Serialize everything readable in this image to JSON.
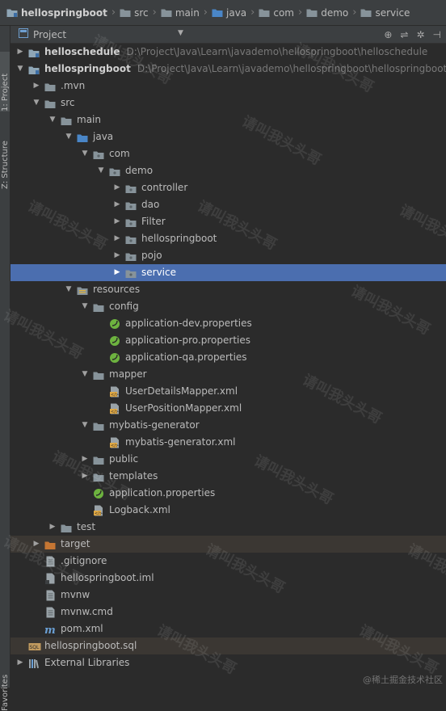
{
  "breadcrumb": [
    {
      "label": "hellospringboot",
      "icon": "module-folder-icon"
    },
    {
      "label": "src",
      "icon": "folder-icon"
    },
    {
      "label": "main",
      "icon": "folder-icon"
    },
    {
      "label": "java",
      "icon": "source-folder-icon"
    },
    {
      "label": "com",
      "icon": "folder-icon"
    },
    {
      "label": "demo",
      "icon": "folder-icon"
    },
    {
      "label": "service",
      "icon": "folder-icon"
    }
  ],
  "side_tabs": {
    "project": "1: Project",
    "structure": "Z: Structure",
    "favorites": "Favorites"
  },
  "panel": {
    "title": "Project"
  },
  "tree": [
    {
      "label": "helloschedule",
      "path": "D:\\Project\\Java\\Learn\\javademo\\hellospringboot\\helloschedule",
      "icon": "module-icon",
      "level": 0,
      "arrow": "right",
      "bold": true
    },
    {
      "label": "hellospringboot",
      "path": "D:\\Project\\Java\\Learn\\javademo\\hellospringboot\\hellospringboot",
      "icon": "module-icon",
      "level": 0,
      "arrow": "down",
      "bold": true
    },
    {
      "label": ".mvn",
      "icon": "folder-icon",
      "level": 1,
      "arrow": "right"
    },
    {
      "label": "src",
      "icon": "folder-icon",
      "level": 1,
      "arrow": "down"
    },
    {
      "label": "main",
      "icon": "folder-icon",
      "level": 2,
      "arrow": "down"
    },
    {
      "label": "java",
      "icon": "source-folder-icon",
      "level": 3,
      "arrow": "down"
    },
    {
      "label": "com",
      "icon": "package-icon",
      "level": 4,
      "arrow": "down"
    },
    {
      "label": "demo",
      "icon": "package-icon",
      "level": 5,
      "arrow": "down"
    },
    {
      "label": "controller",
      "icon": "package-icon",
      "level": 6,
      "arrow": "right"
    },
    {
      "label": "dao",
      "icon": "package-icon",
      "level": 6,
      "arrow": "right"
    },
    {
      "label": "Filter",
      "icon": "package-icon",
      "level": 6,
      "arrow": "right"
    },
    {
      "label": "hellospringboot",
      "icon": "package-icon",
      "level": 6,
      "arrow": "right"
    },
    {
      "label": "pojo",
      "icon": "package-icon",
      "level": 6,
      "arrow": "right"
    },
    {
      "label": "service",
      "icon": "package-icon",
      "level": 6,
      "arrow": "right",
      "selected": true
    },
    {
      "label": "resources",
      "icon": "resources-folder-icon",
      "level": 3,
      "arrow": "down"
    },
    {
      "label": "config",
      "icon": "folder-icon",
      "level": 4,
      "arrow": "down"
    },
    {
      "label": "application-dev.properties",
      "icon": "spring-properties-icon",
      "level": 5
    },
    {
      "label": "application-pro.properties",
      "icon": "spring-properties-icon",
      "level": 5
    },
    {
      "label": "application-qa.properties",
      "icon": "spring-properties-icon",
      "level": 5
    },
    {
      "label": "mapper",
      "icon": "folder-icon",
      "level": 4,
      "arrow": "down"
    },
    {
      "label": "UserDetailsMapper.xml",
      "icon": "xml-file-icon",
      "level": 5
    },
    {
      "label": "UserPositionMapper.xml",
      "icon": "xml-file-icon",
      "level": 5
    },
    {
      "label": "mybatis-generator",
      "icon": "folder-icon",
      "level": 4,
      "arrow": "down"
    },
    {
      "label": "mybatis-generator.xml",
      "icon": "xml-file-icon",
      "level": 5
    },
    {
      "label": "public",
      "icon": "folder-icon",
      "level": 4,
      "arrow": "right"
    },
    {
      "label": "templates",
      "icon": "folder-icon",
      "level": 4,
      "arrow": "right"
    },
    {
      "label": "application.properties",
      "icon": "spring-properties-icon",
      "level": 4
    },
    {
      "label": "Logback.xml",
      "icon": "xml-file-icon",
      "level": 4
    },
    {
      "label": "test",
      "icon": "folder-icon",
      "level": 2,
      "arrow": "right"
    },
    {
      "label": "target",
      "icon": "excluded-folder-icon",
      "level": 1,
      "arrow": "right",
      "highlight": true
    },
    {
      "label": ".gitignore",
      "icon": "text-file-icon",
      "level": 1
    },
    {
      "label": "hellospringboot.iml",
      "icon": "iml-file-icon",
      "level": 1
    },
    {
      "label": "mvnw",
      "icon": "text-file-icon",
      "level": 1
    },
    {
      "label": "mvnw.cmd",
      "icon": "text-file-icon",
      "level": 1
    },
    {
      "label": "pom.xml",
      "icon": "maven-icon",
      "level": 1
    },
    {
      "label": "hellospringboot.sql",
      "icon": "sql-file-icon",
      "level": 0,
      "highlight": true
    },
    {
      "label": "External Libraries",
      "icon": "libraries-icon",
      "level": 0,
      "arrow": "right"
    }
  ],
  "watermark": "请叫我头头哥",
  "site_mark": "@稀土掘金技术社区",
  "colors": {
    "selection": "#4b6eaf",
    "folder": "#87939a",
    "source": "#4a86c7",
    "package": "#87939a",
    "excluded": "#c57633",
    "spring": "#6db33f",
    "xml": "#e0a843"
  }
}
